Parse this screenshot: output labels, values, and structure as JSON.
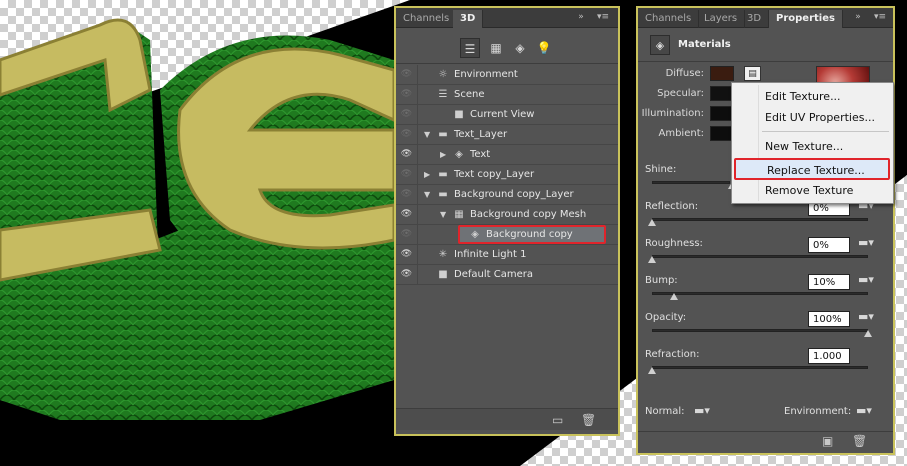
{
  "panel_3d": {
    "tabs": [
      "Channels",
      "3D"
    ],
    "filter_icons": [
      "scene-filter-icon",
      "mesh-filter-icon",
      "material-filter-icon",
      "light-filter-icon"
    ],
    "tree": [
      {
        "label": "Environment",
        "icon": "environment-icon",
        "visible": false,
        "expanded": null
      },
      {
        "label": "Scene",
        "icon": "scene-icon",
        "visible": false,
        "expanded": null
      },
      {
        "label": "Current View",
        "icon": "camera-icon",
        "visible": false,
        "expanded": null
      },
      {
        "label": "Text_Layer",
        "icon": "folder-icon",
        "visible": false,
        "expanded": true
      },
      {
        "label": "Text",
        "icon": "material-icon",
        "visible": true,
        "expanded": false
      },
      {
        "label": "Text copy_Layer",
        "icon": "folder-icon",
        "visible": false,
        "expanded": false
      },
      {
        "label": "Background copy_Layer",
        "icon": "folder-icon",
        "visible": false,
        "expanded": true
      },
      {
        "label": "Background copy Mesh",
        "icon": "mesh-icon",
        "visible": true,
        "expanded": true
      },
      {
        "label": "Background copy",
        "icon": "material-icon",
        "visible": false,
        "expanded": null,
        "selected": true
      },
      {
        "label": "Infinite Light 1",
        "icon": "light-icon",
        "visible": true,
        "expanded": null
      },
      {
        "label": "Default Camera",
        "icon": "camera-icon",
        "visible": true,
        "expanded": null
      }
    ]
  },
  "properties": {
    "tabs": [
      "Channels",
      "Layers",
      "3D",
      "Properties"
    ],
    "title": "Materials",
    "colors": {
      "diffuse": "#3a1c10",
      "specular": "#111111",
      "illumination": "#0d0d0d",
      "ambient": "#0d0d0d",
      "highlight": "#e0242b",
      "panel_border": "#c9c25b"
    },
    "color_rows": [
      "Diffuse:",
      "Specular:",
      "Illumination:",
      "Ambient:"
    ],
    "sliders": [
      {
        "label": "Shine:",
        "value": "",
        "level": 0.37
      },
      {
        "label": "Reflection:",
        "value": "0%",
        "level": 0.0
      },
      {
        "label": "Roughness:",
        "value": "0%",
        "level": 0.0
      },
      {
        "label": "Bump:",
        "value": "10%",
        "level": 0.1
      },
      {
        "label": "Opacity:",
        "value": "100%",
        "level": 1.0
      },
      {
        "label": "Refraction:",
        "value": "1.000",
        "level": 0.0
      }
    ],
    "normal_label": "Normal:",
    "environment_label": "Environment:"
  },
  "context_menu": {
    "items": [
      "Edit Texture...",
      "Edit UV Properties...",
      "New Texture...",
      "Replace Texture...",
      "Remove Texture"
    ],
    "highlighted": "Replace Texture..."
  }
}
